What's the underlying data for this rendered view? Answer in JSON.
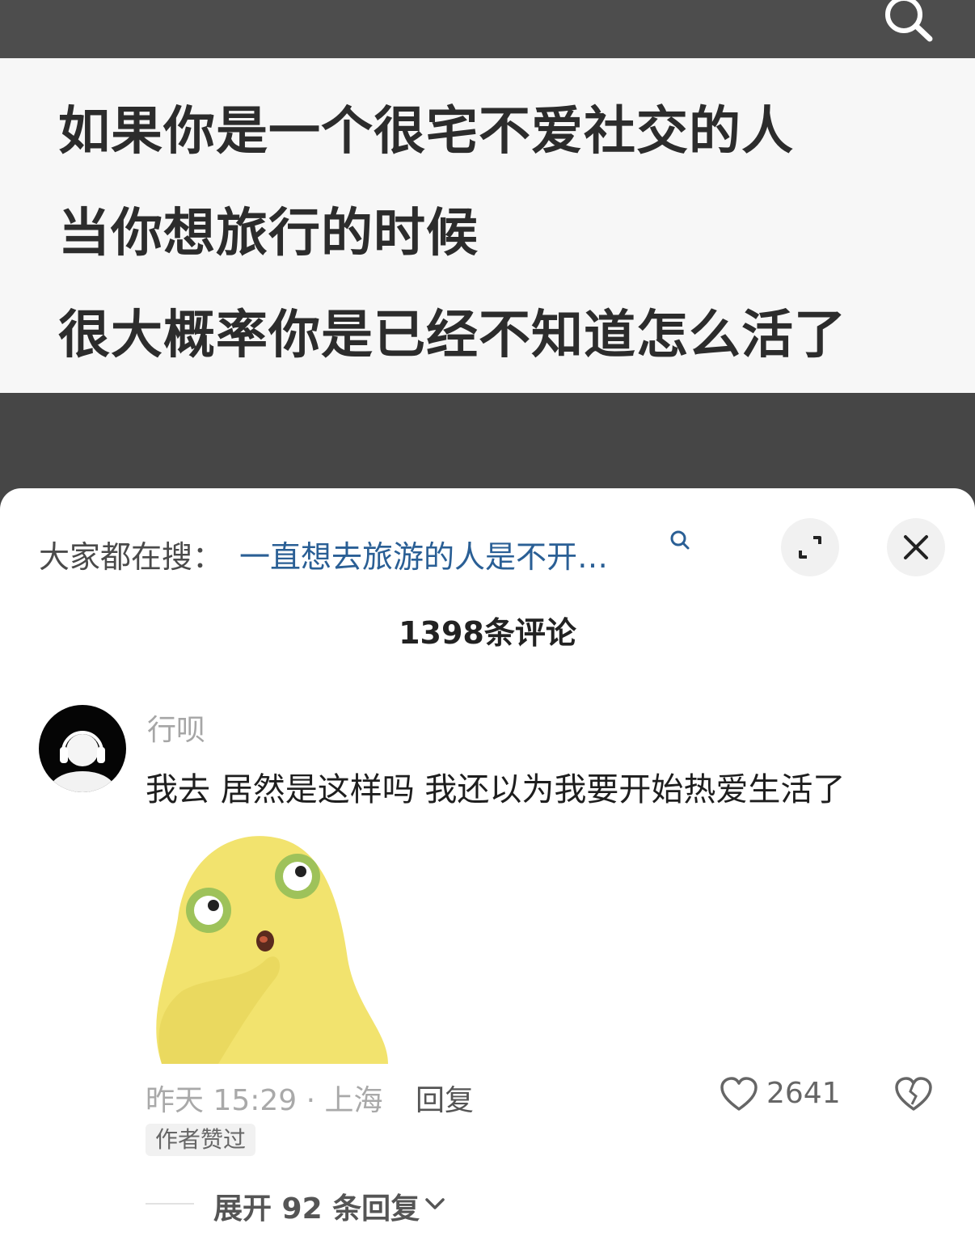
{
  "video": {
    "caption_lines": [
      "如果你是一个很宅不爱社交的人",
      "当你想旅行的时候",
      "很大概率你是已经不知道怎么活了"
    ],
    "icons": {
      "search": "search-icon"
    }
  },
  "comments_sheet": {
    "search_suggest": {
      "prefix": "大家都在搜：",
      "query": "一直想去旅游的人是不开…",
      "icon": "search-icon"
    },
    "buttons": {
      "expand_icon": "expand-icon",
      "close_icon": "close-icon"
    },
    "count_label": "1398条评论",
    "comment": {
      "username": "行呗",
      "text": "我去 居然是这样吗 我还以为我要开始热爱生活了",
      "time_location": "昨天 15:29 · 上海",
      "reply_label": "回复",
      "like_count": "2641",
      "author_badge": "作者赞过",
      "expand_replies_label": "展开 92 条回复",
      "colors": {
        "sticker_yellow": "#f2e36e",
        "eye_green": "#9ec25a"
      }
    }
  }
}
